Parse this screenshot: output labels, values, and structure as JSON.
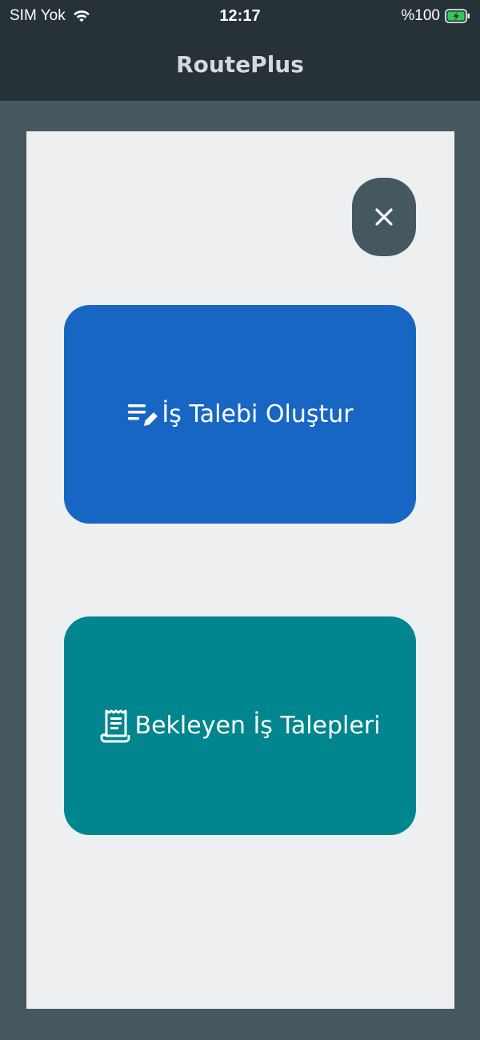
{
  "status_bar": {
    "carrier": "SIM Yok",
    "time": "12:17",
    "battery_percent": "%100"
  },
  "header": {
    "title": "RoutePlus"
  },
  "modal": {
    "close_icon": "close-icon",
    "actions": [
      {
        "label": "İş Talebi Oluştur",
        "icon": "edit-list-icon",
        "color": "#1866c4"
      },
      {
        "label": "Bekleyen İş Talepleri",
        "icon": "receipt-icon",
        "color": "#01858e"
      }
    ]
  },
  "colors": {
    "header_bg": "#263138",
    "backdrop": "#465961",
    "modal_bg": "#eeeff1",
    "close_button_bg": "#455860",
    "battery_green": "#34c759"
  }
}
